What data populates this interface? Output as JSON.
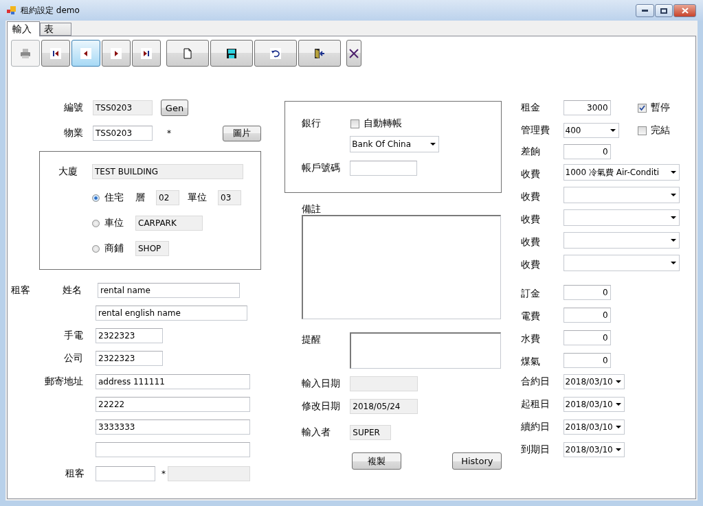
{
  "window": {
    "title": "租約設定 demo"
  },
  "tabs": [
    {
      "label": "輸入",
      "selected": true
    },
    {
      "label": "表",
      "selected": false
    }
  ],
  "toolbar": [
    {
      "kind": "print",
      "disabled": true,
      "highlighted": false
    },
    {
      "kind": "first",
      "disabled": false,
      "highlighted": false
    },
    {
      "kind": "prev",
      "disabled": false,
      "highlighted": true
    },
    {
      "kind": "next",
      "disabled": false,
      "highlighted": false
    },
    {
      "kind": "last",
      "disabled": false,
      "highlighted": false
    },
    {
      "kind": "new",
      "disabled": false,
      "highlighted": false
    },
    {
      "kind": "save",
      "disabled": false,
      "highlighted": false
    },
    {
      "kind": "undo",
      "disabled": false,
      "highlighted": false
    },
    {
      "kind": "exit",
      "disabled": false,
      "highlighted": false
    },
    {
      "kind": "delete",
      "disabled": false,
      "highlighted": false
    }
  ],
  "property": {
    "code_label": "編號",
    "code": {
      "value": "TSS0203",
      "readonly": true
    },
    "gen_button": "Gen",
    "property_label": "物業",
    "property": {
      "value": "TSS0203",
      "readonly": false
    },
    "required_mark": "*",
    "picture_button": "圖片"
  },
  "building": {
    "label": "大廈",
    "field": {
      "value": "TEST BUILDING",
      "readonly": true
    },
    "units": [
      {
        "label": "住宅",
        "selected": true,
        "fields": [
          {
            "label": "層",
            "value": "02",
            "readonly": true
          },
          {
            "label": "單位",
            "value": "03",
            "readonly": true
          }
        ]
      },
      {
        "label": "車位",
        "selected": false,
        "fields": [
          {
            "value": "CARPARK",
            "readonly": true
          }
        ]
      },
      {
        "label": "商鋪",
        "selected": false,
        "fields": [
          {
            "value": "SHOP",
            "readonly": true
          }
        ]
      }
    ]
  },
  "tenant": {
    "section_label": "租客",
    "name_label": "姓名",
    "name": {
      "value": "rental name",
      "readonly": false
    },
    "english_name": {
      "value": "rental english name",
      "readonly": false
    },
    "mobile_label": "手電",
    "mobile": {
      "value": "2322323",
      "readonly": false
    },
    "office_label": "公司",
    "office": {
      "value": "2322323",
      "readonly": false
    },
    "address_label": "郵寄地址",
    "address_lines": [
      {
        "value": "address 111111",
        "readonly": false
      },
      {
        "value": "22222",
        "readonly": false
      },
      {
        "value": "3333333",
        "readonly": false
      },
      {
        "readonly": false
      }
    ],
    "tenant_label": "租客",
    "tenant_code": {
      "readonly": false
    },
    "required_mark": "*",
    "tenant_name": {
      "readonly": true
    }
  },
  "bank": {
    "label": "銀行",
    "auto_transfer": {
      "label": "自動轉帳",
      "checked": false
    },
    "bank": "Bank Of China",
    "account_label": "帳戶號碼",
    "account": {
      "readonly": false
    }
  },
  "remarks": {
    "label": "備註"
  },
  "reminder": {
    "label": "提醒"
  },
  "audit": [
    {
      "label": "輸入日期",
      "field": {
        "readonly": true
      }
    },
    {
      "label": "修改日期",
      "field": {
        "value": "2018/05/24",
        "readonly": true
      }
    },
    {
      "label": "輸入者",
      "field": {
        "value": "SUPER",
        "readonly": true
      }
    }
  ],
  "buttons": [
    "複製",
    "History"
  ],
  "fees": [
    {
      "kind": "number",
      "label": "租金",
      "value": "3000"
    },
    {
      "kind": "combo",
      "label": "管理費",
      "value": "400"
    },
    {
      "kind": "number",
      "label": "差餉",
      "value": "0"
    }
  ],
  "flags": [
    {
      "label": "暫停",
      "checked": true
    },
    {
      "label": "完結",
      "checked": false
    }
  ],
  "charges": [
    {
      "label": "收費",
      "value": "1000 冷氣費 Air-Conditi"
    },
    {
      "label": "收費"
    },
    {
      "label": "收費"
    },
    {
      "label": "收費"
    },
    {
      "label": "收費"
    }
  ],
  "utilities": [
    {
      "label": "訂金",
      "value": "0"
    },
    {
      "label": "電費",
      "value": "0"
    },
    {
      "label": "水費",
      "value": "0"
    },
    {
      "label": "煤氣",
      "value": "0"
    }
  ],
  "dates": [
    {
      "label": "合約日",
      "value": "2018/03/10"
    },
    {
      "label": "起租日",
      "value": "2018/03/10"
    },
    {
      "label": "續約日",
      "value": "2018/03/10"
    },
    {
      "label": "到期日",
      "value": "2018/03/10"
    }
  ]
}
